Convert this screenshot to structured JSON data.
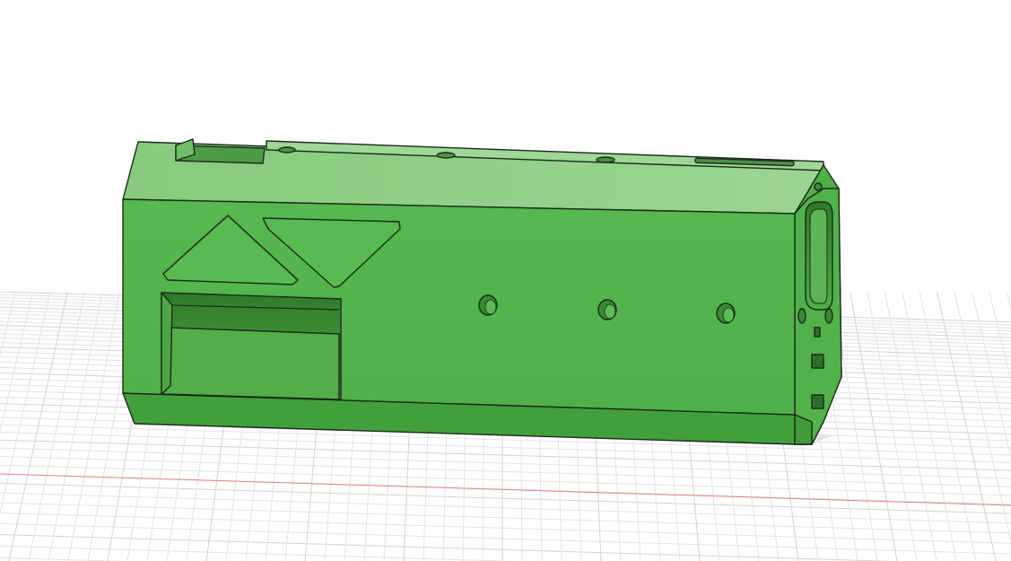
{
  "viewport": {
    "background": "#ffffff"
  },
  "grid": {
    "line_color": "#e3e3e3",
    "major_line_color": "#d2d2d2",
    "axis_color": "#e88080"
  },
  "model": {
    "color": "#54b74d",
    "top_color": "#89cc7f",
    "bottom_color": "#3f9a3a",
    "edge_color": "#1b2a1a",
    "inner_color": "#3e9136"
  }
}
